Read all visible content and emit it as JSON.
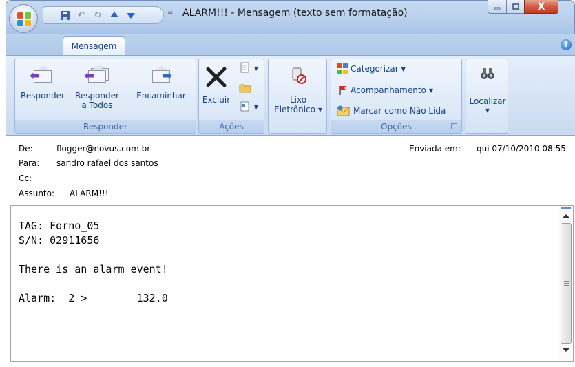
{
  "window": {
    "title": "ALARM!!! - Mensagem (texto sem formatação)",
    "qat_dropdown_glyph": "=",
    "close_glyph": "X"
  },
  "ribbon": {
    "tab": "Mensagem",
    "help_glyph": "?",
    "groups": {
      "responder": {
        "label": "Responder",
        "reply": "Responder",
        "reply_all_1": "Responder",
        "reply_all_2": "a Todos",
        "forward": "Encaminhar"
      },
      "acoes": {
        "label": "Ações",
        "delete": "Excluir"
      },
      "junk": {
        "line1": "Lixo",
        "line2": "Eletrônico"
      },
      "opcoes": {
        "label": "Opções",
        "categorize": "Categorizar",
        "followup": "Acompanhamento",
        "mark_unread": "Marcar como Não Lida"
      },
      "find": {
        "label": "Localizar"
      }
    }
  },
  "header": {
    "from_label": "De:",
    "from": "flogger@novus.com.br",
    "sent_label": "Enviada em:",
    "sent": "qui 07/10/2010 08:55",
    "to_label": "Para:",
    "to": "sandro rafael dos santos",
    "cc_label": "Cc:",
    "cc": "",
    "subject_label": "Assunto:",
    "subject": "ALARM!!!"
  },
  "message": {
    "line1": "TAG: Forno_05",
    "line2": "S/N: 02911656",
    "line3": "",
    "line4": "There is an alarm event!",
    "line5": "",
    "line6": "Alarm:  2 >        132.0"
  }
}
